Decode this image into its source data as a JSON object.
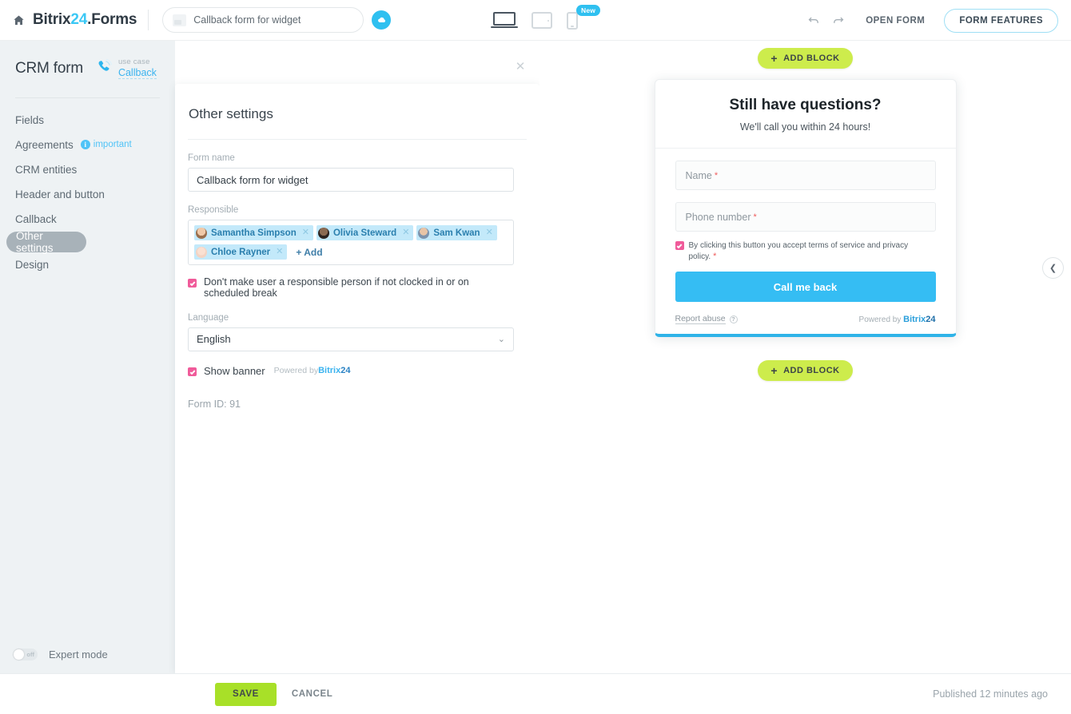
{
  "topbar": {
    "home_icon": "home-icon",
    "brand_prefix": "Bitrix",
    "brand_accent": "24",
    "brand_suffix": ".Forms",
    "form_name_value": "Callback form for widget",
    "cloud_icon": "cloud-icon",
    "devices": [
      {
        "name": "desktop",
        "icon": "laptop-icon",
        "active": true,
        "badge": ""
      },
      {
        "name": "tablet",
        "icon": "tablet-icon",
        "active": false,
        "badge": ""
      },
      {
        "name": "mobile",
        "icon": "phone-icon",
        "active": false,
        "badge": "New"
      }
    ],
    "undo_icon": "undo-icon",
    "redo_icon": "redo-icon",
    "open_form_label": "OPEN FORM",
    "form_features_label": "FORM FEATURES"
  },
  "sidebar": {
    "title": "CRM form",
    "use_case_label": "use case",
    "use_case_value": "Callback",
    "phone_icon": "phone-call-icon",
    "items": [
      {
        "label": "Fields",
        "active": false,
        "badge": ""
      },
      {
        "label": "Agreements",
        "active": false,
        "badge": "important"
      },
      {
        "label": "CRM entities",
        "active": false,
        "badge": ""
      },
      {
        "label": "Header and button",
        "active": false,
        "badge": ""
      },
      {
        "label": "Callback",
        "active": false,
        "badge": ""
      },
      {
        "label": "Other settings",
        "active": true,
        "badge": ""
      },
      {
        "label": "Design",
        "active": false,
        "badge": ""
      }
    ],
    "expert_mode_label": "Expert mode",
    "expert_mode_state": "off"
  },
  "settings": {
    "close_icon": "close-icon",
    "title": "Other settings",
    "form_name_label": "Form name",
    "form_name_value": "Callback form for widget",
    "responsible_label": "Responsible",
    "responsible": [
      {
        "name": "Samantha Simpson",
        "avatar_color": "#c49a7a"
      },
      {
        "name": "Olivia Steward",
        "avatar_color": "#4a3a33"
      },
      {
        "name": "Sam Kwan",
        "avatar_color": "#8aa3bd"
      },
      {
        "name": "Chloe Rayner",
        "avatar_color": "#f0cfc0"
      }
    ],
    "add_label": "+ Add",
    "remove_icon": "remove-chip-icon",
    "no_responsible_checkbox_label": "Don't make user a responsible person if not clocked in or on scheduled break",
    "no_responsible_checked": true,
    "language_label": "Language",
    "language_value": "English",
    "language_chevron": "chevron-down-icon",
    "show_banner_label": "Show banner",
    "show_banner_checked": true,
    "powered_by_text": "Powered by",
    "powered_by_brand1": "Bitrix",
    "powered_by_brand2": "24",
    "form_id_text": "Form ID: 91"
  },
  "preview": {
    "add_block_top_label": "ADD BLOCK",
    "add_block_bottom_label": "ADD BLOCK",
    "add_block_icon": "plus-icon",
    "card": {
      "heading": "Still have questions?",
      "subheading": "We'll call you within 24 hours!",
      "fields": [
        {
          "placeholder": "Name",
          "required": "*"
        },
        {
          "placeholder": "Phone number",
          "required": "*"
        }
      ],
      "agreement_text": "By clicking this button you accept terms of service and privacy policy.",
      "agreement_required": "*",
      "agreement_checked": true,
      "submit_label": "Call me back",
      "report_abuse_label": "Report abuse",
      "help_icon": "question-mark-icon",
      "powered_by_text": "Powered by",
      "powered_by_brand1": "Bitrix",
      "powered_by_brand2": "24"
    },
    "collapse_icon": "chevron-left-icon"
  },
  "bottombar": {
    "save_label": "SAVE",
    "cancel_label": "CANCEL",
    "published_text": "Published 12 minutes ago"
  },
  "colors": {
    "brand_blue": "#3bc8f5",
    "accent_green": "#a8e028",
    "add_block_green": "#cdec4c",
    "checkbox_pink": "#f05b9a",
    "submit_blue": "#35bdf3",
    "chip_blue": "#c3e9fa",
    "panel_grey": "#eef2f4"
  }
}
